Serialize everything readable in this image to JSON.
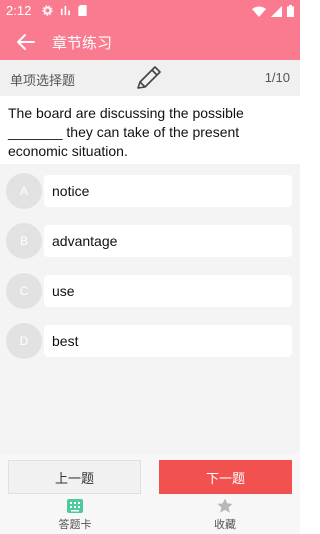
{
  "status_bar": {
    "time": "2:12"
  },
  "app_bar": {
    "title": "章节练习"
  },
  "question_header": {
    "type_label": "单项选择题",
    "counter": "1/10"
  },
  "question": {
    "text": "The board are discussing the possible _______ they can take of the present economic situation."
  },
  "options": [
    {
      "letter": "A",
      "text": "notice"
    },
    {
      "letter": "B",
      "text": "advantage"
    },
    {
      "letter": "C",
      "text": "use"
    },
    {
      "letter": "D",
      "text": "best"
    }
  ],
  "buttons": {
    "prev": "上一题",
    "next": "下一题"
  },
  "tabs": {
    "answer_card": "答题卡",
    "favorite": "收藏"
  },
  "colors": {
    "primary": "#fa7b8f",
    "next_button": "#f2524f",
    "answer_card_icon": "#4ecb9a"
  }
}
